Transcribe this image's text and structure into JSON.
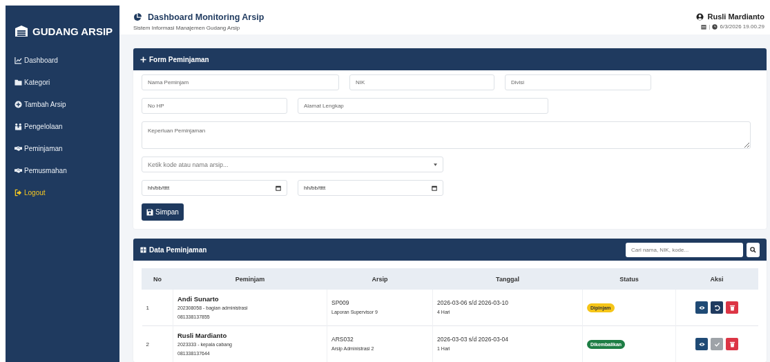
{
  "sidebar": {
    "brand": "GUDANG ARSIP",
    "items": [
      {
        "label": "Dashboard",
        "kind": "dashboard"
      },
      {
        "label": "Kategori",
        "kind": "category"
      },
      {
        "label": "Tambah Arsip",
        "kind": "add"
      },
      {
        "label": "Pengelolaan",
        "kind": "manage"
      },
      {
        "label": "Peminjaman",
        "kind": "loan"
      },
      {
        "label": "Pemusmahan",
        "kind": "disposal"
      },
      {
        "label": "Logout",
        "kind": "logout"
      }
    ]
  },
  "header": {
    "title": "Dashboard Monitoring Arsip",
    "subtitle": "Sistem Informasi Manajemen Gudang Arsip",
    "user": "Rusli Mardianto",
    "separator": "|",
    "datetime": "6/3/2026 19.00.29"
  },
  "form": {
    "title": "Form Peminjaman",
    "name": {
      "placeholder": "Nama Peminjam"
    },
    "nik": {
      "placeholder": "NIK"
    },
    "divisi": {
      "placeholder": "Divisi"
    },
    "phone": {
      "placeholder": "No HP"
    },
    "address": {
      "placeholder": "Alamat Lengkap"
    },
    "purpose": {
      "placeholder": "Keperluan Peminjaman"
    },
    "archive": {
      "placeholder": "Ketik kode atau nama arsip..."
    },
    "date_start": {
      "value": "hh/bb/tttt"
    },
    "date_end": {
      "value": "hh/bb/tttt"
    },
    "save_button": "Simpan"
  },
  "table": {
    "title": "Data Peminjaman",
    "search": {
      "placeholder": "Cari nama, NIK, kode..."
    },
    "columns": [
      "No",
      "Peminjam",
      "Arsip",
      "Tanggal",
      "Status",
      "Aksi"
    ],
    "rows": [
      {
        "no": "1",
        "name": "Andi Sunarto",
        "detail": "202308058 - bagian administrasi",
        "phone": "081338137855",
        "code": "SP009",
        "archive": "Laporan Supervisor 9",
        "range": "2026-03-06 s/d 2026-03-10",
        "duration": "4 Hari",
        "status": {
          "label": "Dipinjam",
          "kind": "borrowed"
        },
        "actions": [
          {
            "kind": "view",
            "disabled": false
          },
          {
            "kind": "return",
            "disabled": false
          },
          {
            "kind": "delete",
            "disabled": false
          }
        ]
      },
      {
        "no": "2",
        "name": "Rusli Mardianto",
        "detail": "2023333 - kepala cabang",
        "phone": "081338137644",
        "code": "ARS032",
        "archive": "Arsip Administrasi 2",
        "range": "2026-03-03 s/d 2026-03-04",
        "duration": "1 Hari",
        "status": {
          "label": "Dikembalikan",
          "kind": "returned"
        },
        "actions": [
          {
            "kind": "view",
            "disabled": false
          },
          {
            "kind": "confirm",
            "disabled": true
          },
          {
            "kind": "delete",
            "disabled": false
          }
        ]
      }
    ]
  }
}
